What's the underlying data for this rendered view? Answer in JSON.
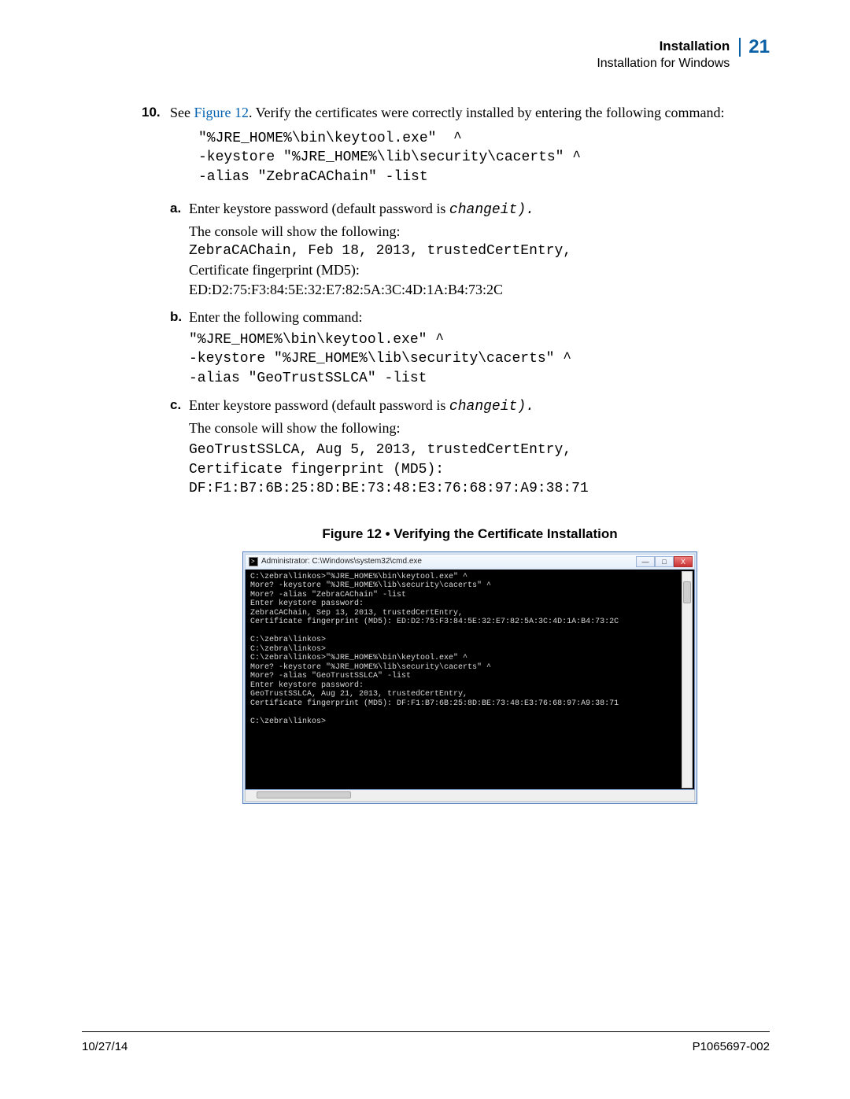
{
  "header": {
    "title": "Installation",
    "subtitle": "Installation for Windows",
    "pagenum": "21"
  },
  "step": {
    "num": "10.",
    "pre": "See ",
    "figref": "Figure 12",
    "post": ". Verify the certificates were correctly installed by entering the following command:",
    "cmd": "\"%JRE_HOME%\\bin\\keytool.exe\"  ^\n-keystore \"%JRE_HOME%\\lib\\security\\cacerts\" ^\n-alias \"ZebraCAChain\" -list"
  },
  "sub": {
    "a": {
      "lbl": "a.",
      "t1a": "Enter keystore password (default password is ",
      "pw": "changeit).",
      "t2": "The console will show the following:",
      "out1": "ZebraCAChain, Feb 18, 2013, trustedCertEntry,",
      "t3": "Certificate fingerprint (MD5):",
      "t4": "ED:D2:75:F3:84:5E:32:E7:82:5A:3C:4D:1A:B4:73:2C"
    },
    "b": {
      "lbl": "b.",
      "t1": "Enter the following command:",
      "cmd": "\"%JRE_HOME%\\bin\\keytool.exe\" ^\n-keystore \"%JRE_HOME%\\lib\\security\\cacerts\" ^\n-alias \"GeoTrustSSLCA\" -list"
    },
    "c": {
      "lbl": "c.",
      "t1a": "Enter keystore password (default password is ",
      "pw": "changeit).",
      "t2": "The console will show the following:",
      "out": "GeoTrustSSLCA, Aug 5, 2013, trustedCertEntry,\nCertificate fingerprint (MD5):\nDF:F1:B7:6B:25:8D:BE:73:48:E3:76:68:97:A9:38:71"
    }
  },
  "figure": {
    "caption": "Figure 12 • Verifying the Certificate Installation"
  },
  "console": {
    "title": "Administrator: C:\\Windows\\system32\\cmd.exe",
    "body": "C:\\zebra\\linkos>\"%JRE_HOME%\\bin\\keytool.exe\" ^\nMore? -keystore \"%JRE_HOME%\\lib\\security\\cacerts\" ^\nMore? -alias \"ZebraCAChain\" -list\nEnter keystore password:\nZebraCAChain, Sep 13, 2013, trustedCertEntry,\nCertificate fingerprint (MD5): ED:D2:75:F3:84:5E:32:E7:82:5A:3C:4D:1A:B4:73:2C\n\nC:\\zebra\\linkos>\nC:\\zebra\\linkos>\nC:\\zebra\\linkos>\"%JRE_HOME%\\bin\\keytool.exe\" ^\nMore? -keystore \"%JRE_HOME%\\lib\\security\\cacerts\" ^\nMore? -alias \"GeoTrustSSLCA\" -list\nEnter keystore password:\nGeoTrustSSLCA, Aug 21, 2013, trustedCertEntry,\nCertificate fingerprint (MD5): DF:F1:B7:6B:25:8D:BE:73:48:E3:76:68:97:A9:38:71\n\nC:\\zebra\\linkos>",
    "buttons": {
      "min": "—",
      "max": "□",
      "close": "X"
    }
  },
  "footer": {
    "date": "10/27/14",
    "docid": "P1065697-002"
  }
}
